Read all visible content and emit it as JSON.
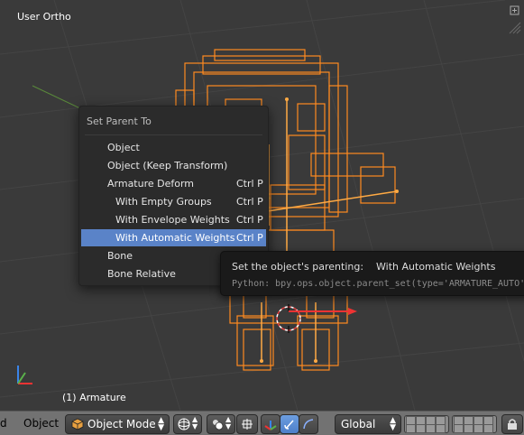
{
  "viewport": {
    "title": "User Ortho",
    "status": "(1) Armature"
  },
  "menu": {
    "title": "Set Parent To",
    "items": [
      {
        "label": "Object",
        "shortcut": "",
        "sub": false,
        "highlighted": false
      },
      {
        "label": "Object (Keep Transform)",
        "shortcut": "",
        "sub": false,
        "highlighted": false
      },
      {
        "label": "Armature Deform",
        "shortcut": "Ctrl P",
        "sub": false,
        "highlighted": false
      },
      {
        "label": "With Empty Groups",
        "shortcut": "Ctrl P",
        "sub": true,
        "highlighted": false
      },
      {
        "label": "With Envelope Weights",
        "shortcut": "Ctrl P",
        "sub": true,
        "highlighted": false
      },
      {
        "label": "With Automatic Weights",
        "shortcut": "Ctrl P",
        "sub": true,
        "highlighted": true
      },
      {
        "label": "Bone",
        "shortcut": "",
        "sub": false,
        "highlighted": false
      },
      {
        "label": "Bone Relative",
        "shortcut": "",
        "sub": false,
        "highlighted": false
      }
    ]
  },
  "tooltip": {
    "heading": "Set the object's parenting:",
    "value": "With Automatic Weights",
    "python": "Python: bpy.ops.object.parent_set(type='ARMATURE_AUTO')"
  },
  "header": {
    "menu_label": "d",
    "object_label": "Object",
    "mode_label": "Object Mode",
    "orientation_label": "Global"
  },
  "colors": {
    "selection": "#ff8a1f",
    "highlight": "#5a83c8",
    "viewport_bg": "#3a3a3a"
  }
}
